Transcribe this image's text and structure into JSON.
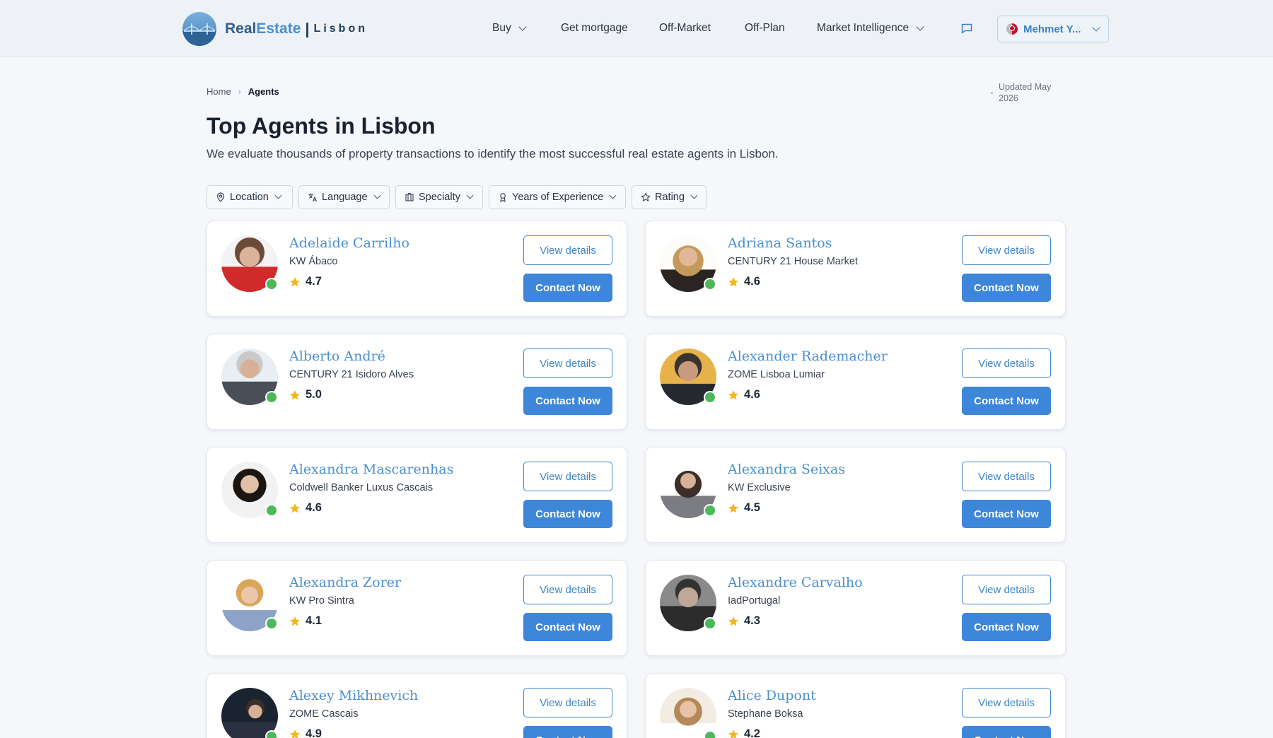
{
  "header": {
    "logo_real": "Real",
    "logo_estate": "Estate",
    "logo_sep": "|",
    "logo_city": "Lisbon",
    "nav": {
      "buy": "Buy",
      "mortgage": "Get mortgage",
      "off_market": "Off-Market",
      "off_plan": "Off-Plan",
      "market_intel": "Market Intelligence"
    },
    "user_name": "Mehmet Y..."
  },
  "breadcrumb": {
    "home": "Home",
    "current": "Agents"
  },
  "updated": "Updated May 2026",
  "page": {
    "title": "Top Agents in Lisbon",
    "subtitle": "We evaluate thousands of property transactions to identify the most successful real estate agents in Lisbon."
  },
  "filters": {
    "location": "Location",
    "language": "Language",
    "specialty": "Specialty",
    "experience": "Years of Experience",
    "rating": "Rating"
  },
  "buttons": {
    "view": "View details",
    "contact": "Contact Now"
  },
  "agents": [
    {
      "name": "Adelaide Carrilho",
      "agency": "KW Ábaco",
      "rating": "4.7"
    },
    {
      "name": "Adriana Santos",
      "agency": "CENTURY 21 House Market",
      "rating": "4.6"
    },
    {
      "name": "Alberto André",
      "agency": "CENTURY 21 Isidoro Alves",
      "rating": "5.0"
    },
    {
      "name": "Alexander Rademacher",
      "agency": "ZOME Lisboa Lumiar",
      "rating": "4.6"
    },
    {
      "name": "Alexandra Mascarenhas",
      "agency": "Coldwell Banker Luxus Cascais",
      "rating": "4.6"
    },
    {
      "name": "Alexandra Seixas",
      "agency": "KW Exclusive",
      "rating": "4.5"
    },
    {
      "name": "Alexandra Zorer",
      "agency": "KW Pro Sintra",
      "rating": "4.1"
    },
    {
      "name": "Alexandre Carvalho",
      "agency": "IadPortugal",
      "rating": "4.3"
    },
    {
      "name": "Alexey Mikhnevich",
      "agency": "ZOME Cascais",
      "rating": "4.9"
    },
    {
      "name": "Alice Dupont",
      "agency": "Stephane Boksa",
      "rating": "4.2"
    }
  ],
  "colors": {
    "accent": "#3d86d9",
    "name": "#4a8fd0",
    "online": "#4cb85a",
    "star": "#f2b61c"
  }
}
